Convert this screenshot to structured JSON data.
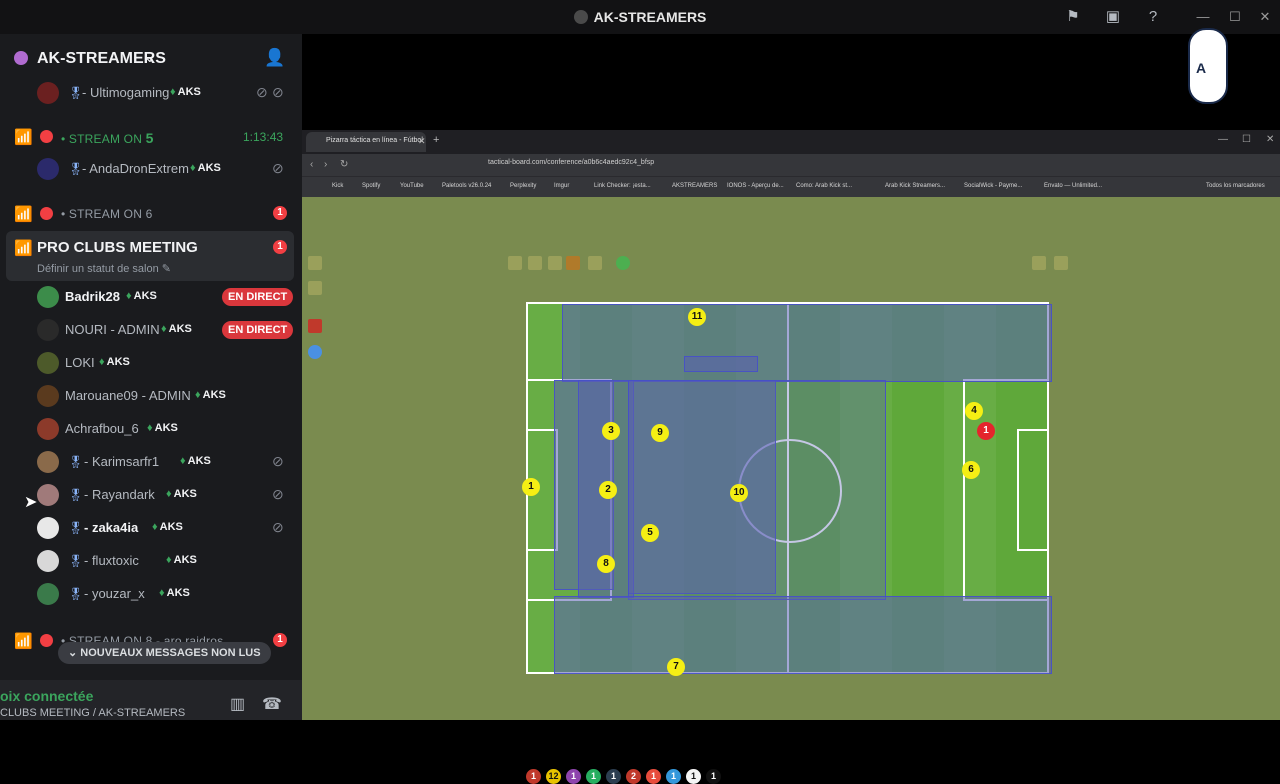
{
  "window": {
    "title": "AK-STREAMERS",
    "icons": [
      "flag-icon",
      "screen-share-icon",
      "help-icon"
    ]
  },
  "server": {
    "name": "AK-STREAMERS",
    "add_user_icon": "add-user-icon"
  },
  "colors": {
    "sidebar_bg": "#1a1b1e",
    "live_red": "#da373c",
    "voice_green": "#3ba55d",
    "pitch_green": "#5fa83a",
    "zone_blue": "#5a5fb4",
    "player_yellow": "#f5ef14"
  },
  "top_user": {
    "name": "- Ultimogaming",
    "tag": "AKS"
  },
  "channels": [
    {
      "prefix": "• STREAM ON ",
      "num": "5",
      "timer": "1:13:43",
      "badge": ""
    },
    {
      "prefix": "• STREAM ON 6",
      "num": "",
      "timer": "",
      "badge": "1"
    },
    {
      "prefix": "• STREAM ON 8 - aro raidros",
      "num": "",
      "timer": "",
      "badge": "1"
    }
  ],
  "stream5_user": {
    "name": "- AndaDronExtrem",
    "tag": "AKS"
  },
  "pro_clubs": {
    "title": "PRO CLUBS MEETING",
    "subtitle": "Définir un statut de salon",
    "badge": "1"
  },
  "members": [
    {
      "name": "Badrik28",
      "tag": "AKS",
      "live": "EN DIRECT",
      "medal": false,
      "bright": true,
      "muted": false
    },
    {
      "name": "NOURI - ADMIN",
      "tag": "AKS",
      "live": "EN DIRECT",
      "medal": false,
      "bright": false,
      "muted": false
    },
    {
      "name": "LOKI",
      "tag": "AKS",
      "live": "",
      "medal": false,
      "bright": false,
      "muted": false
    },
    {
      "name": "Marouane09 - ADMIN",
      "tag": "AKS",
      "live": "",
      "medal": false,
      "bright": false,
      "muted": false
    },
    {
      "name": "Achrafbou_6",
      "tag": "AKS",
      "live": "",
      "medal": false,
      "bright": false,
      "muted": false
    },
    {
      "name": "- Karimsarfr1",
      "tag": "AKS",
      "live": "",
      "medal": true,
      "bright": false,
      "muted": true
    },
    {
      "name": "- Rayandark",
      "tag": "AKS",
      "live": "",
      "medal": true,
      "bright": false,
      "muted": true
    },
    {
      "name": "- zaka4ia",
      "tag": "AKS",
      "live": "",
      "medal": true,
      "bright": true,
      "muted": true
    },
    {
      "name": "- fluxtoxic",
      "tag": "AKS",
      "live": "",
      "medal": true,
      "bright": false,
      "muted": false
    },
    {
      "name": "- youzar_x",
      "tag": "AKS",
      "live": "",
      "medal": true,
      "bright": false,
      "muted": false
    }
  ],
  "new_messages": "NOUVEAUX MESSAGES NON LUS",
  "voice": {
    "status": "oix connectée",
    "channel": "CLUBS MEETING / AK-STREAMERS"
  },
  "browser": {
    "tab_title": "Pizarra táctica en línea - Fútbol",
    "url": "tactical-board.com/conference/a0b6c4aedc92c4_bfsp",
    "bookmarks": [
      "Kick",
      "Spotify",
      "YouTube",
      "Paletools v26.0.24",
      "Perplexity",
      "Imgur",
      "Link Checker: ¡esta...",
      "AKSTREAMERS",
      "IONOS - Aperçu de...",
      "Como: Arab Kick st...",
      "Arab Kick Streamers...",
      "SocialWick - Payme...",
      "Envato — Unlimited...",
      "Todos los marcadores"
    ]
  },
  "board": {
    "players": [
      "11",
      "3",
      "9",
      "1",
      "2",
      "10",
      "5",
      "8",
      "7",
      "4",
      "6"
    ],
    "opponents": [
      "1"
    ],
    "chips": [
      "1",
      "12",
      "1",
      "1",
      "1",
      "2",
      "1",
      "1",
      "1",
      "1"
    ]
  }
}
